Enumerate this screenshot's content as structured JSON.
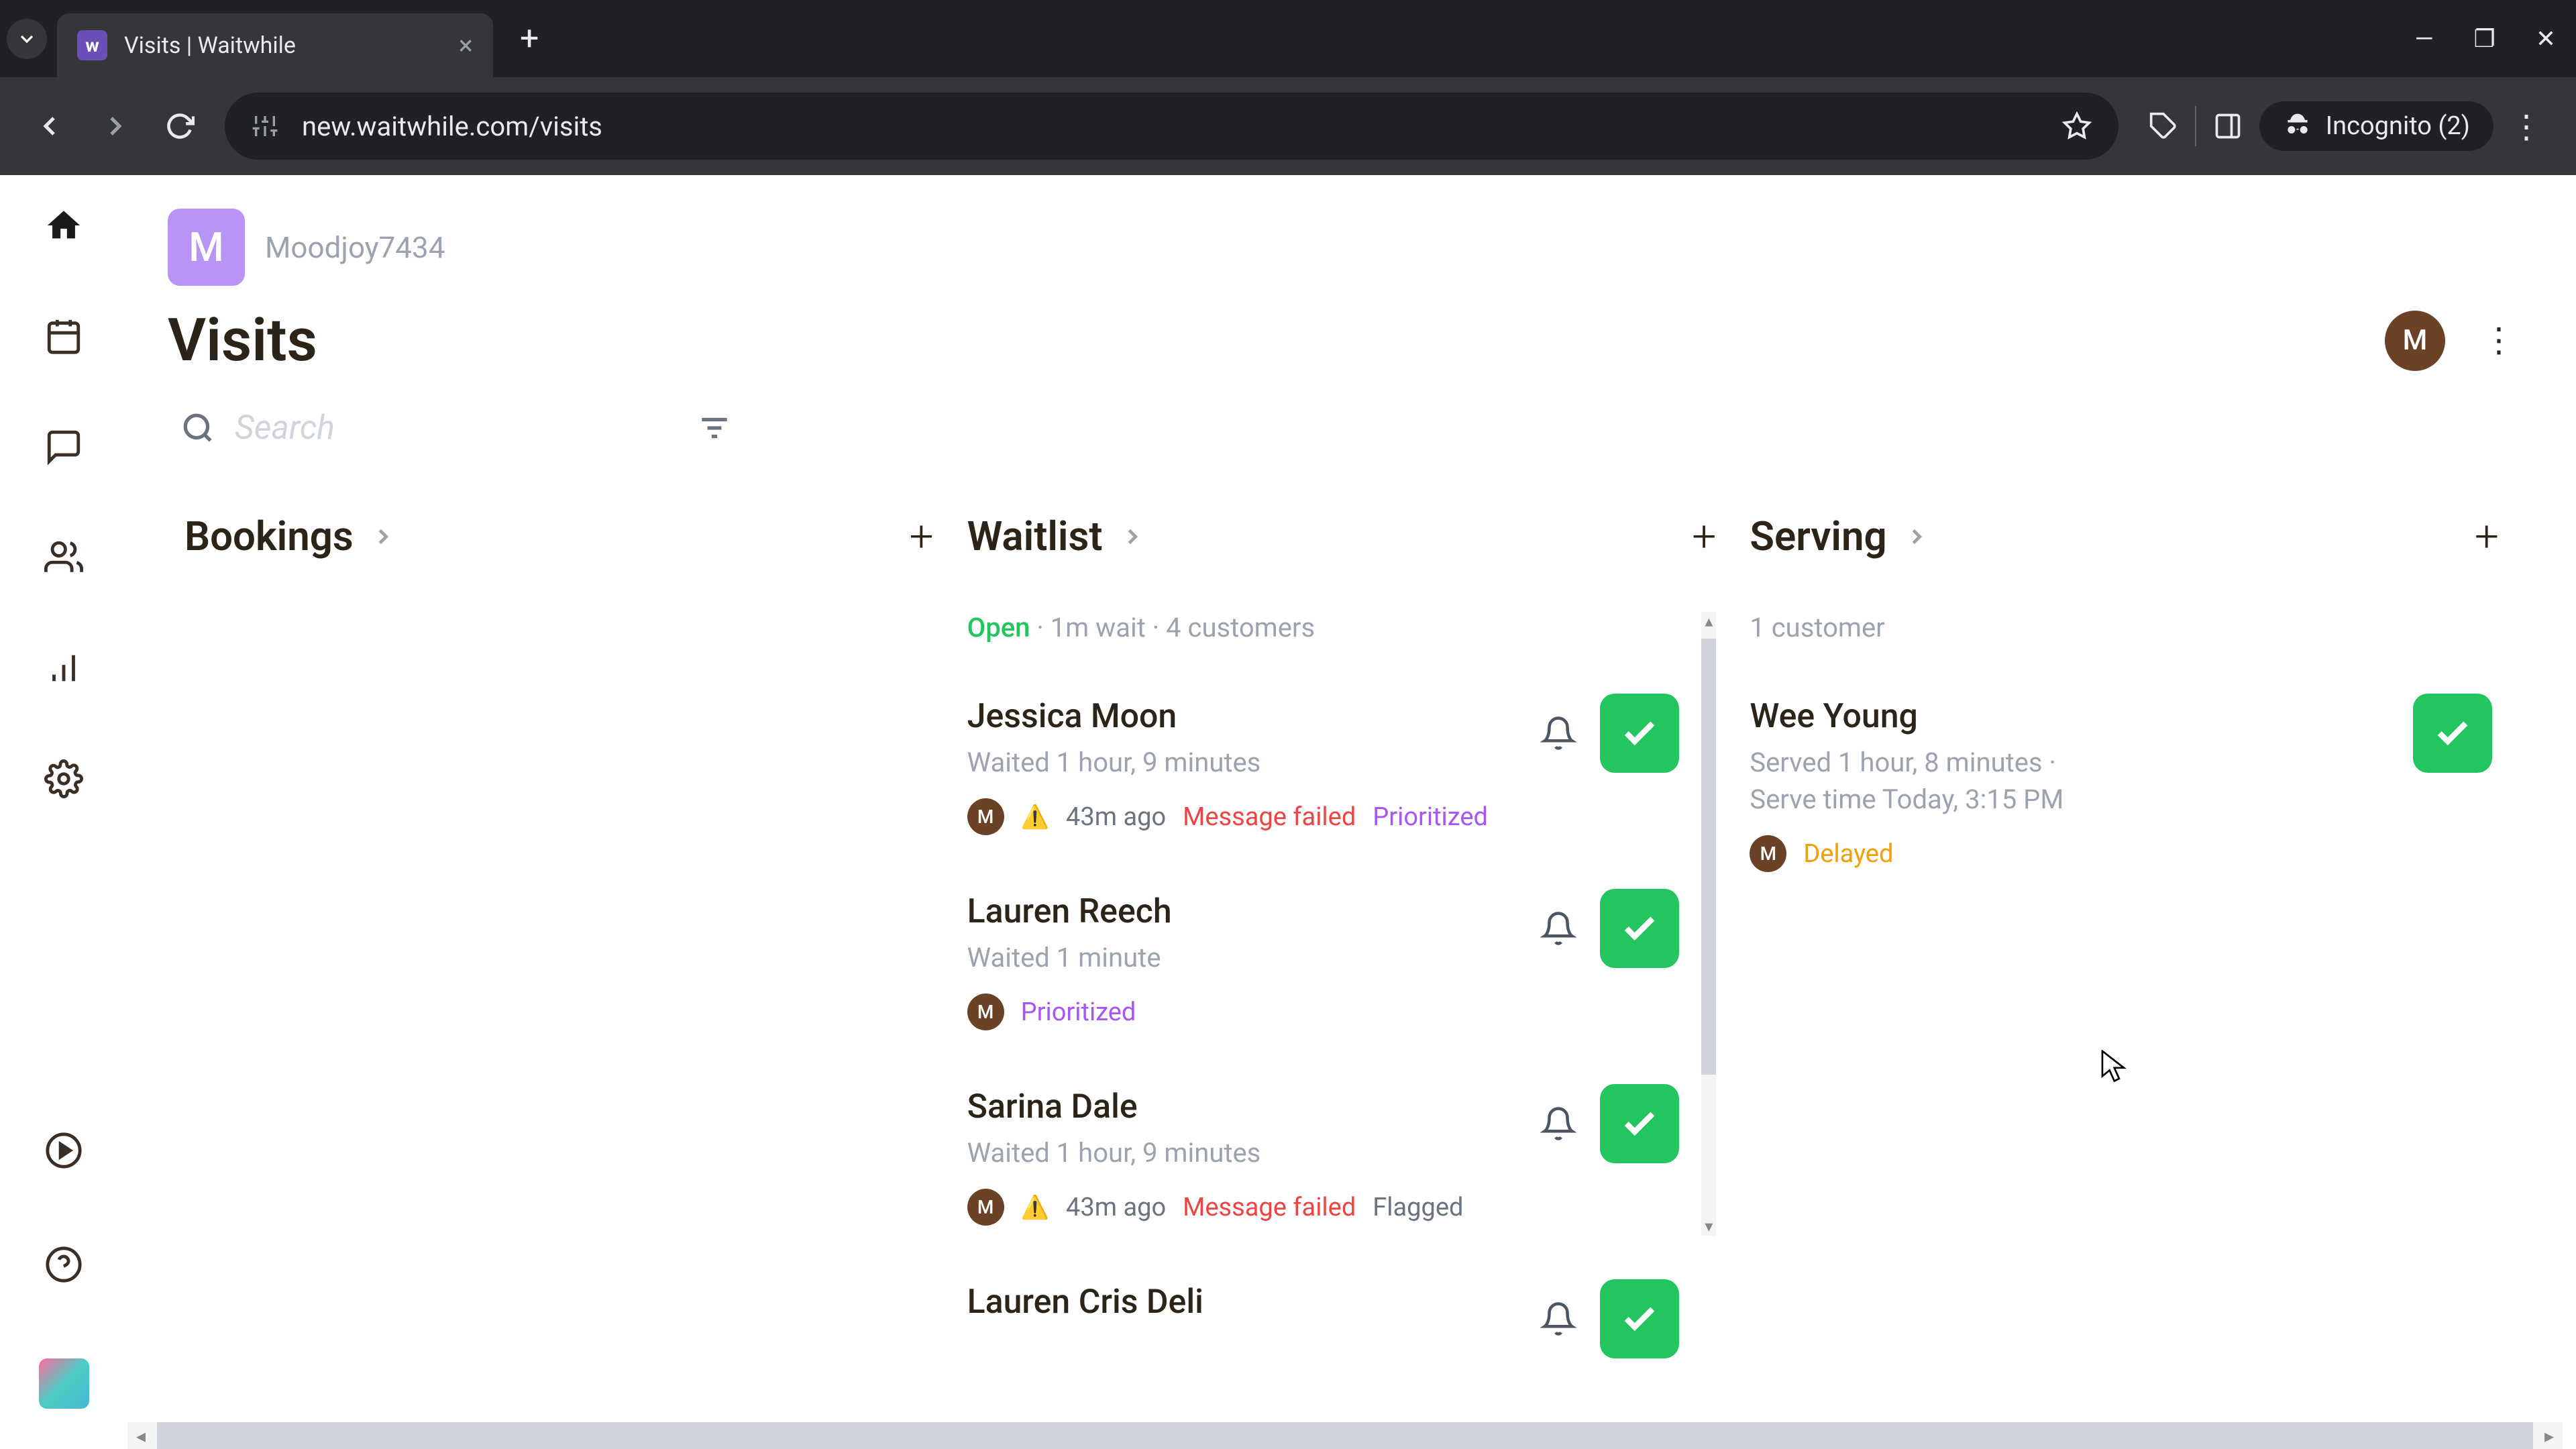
{
  "browser": {
    "tab_title": "Visits | Waitwhile",
    "url": "new.waitwhile.com/visits",
    "incognito_label": "Incognito (2)"
  },
  "workspace": {
    "badge_letter": "M",
    "name": "Moodjoy7434"
  },
  "page": {
    "title": "Visits",
    "avatar_letter": "M"
  },
  "search": {
    "placeholder": "Search"
  },
  "columns": {
    "bookings": {
      "title": "Bookings"
    },
    "waitlist": {
      "title": "Waitlist",
      "status_open": "Open",
      "status_rest": " · 1m wait · 4 customers",
      "items": [
        {
          "name": "Jessica Moon",
          "sub": "Waited 1 hour, 9 minutes",
          "avatar": "M",
          "warn": "⚠️",
          "time": "43m ago",
          "failed": "Message failed",
          "prioritized": "Prioritized",
          "flagged": "",
          "show_bell": true
        },
        {
          "name": "Lauren Reech",
          "sub": "Waited 1 minute",
          "avatar": "M",
          "warn": "",
          "time": "",
          "failed": "",
          "prioritized": "Prioritized",
          "flagged": "",
          "show_bell": true
        },
        {
          "name": "Sarina Dale",
          "sub": "Waited 1 hour, 9 minutes",
          "avatar": "M",
          "warn": "⚠️",
          "time": "43m ago",
          "failed": "Message failed",
          "prioritized": "",
          "flagged": "Flagged",
          "show_bell": true
        },
        {
          "name": "Lauren Cris Deli",
          "sub": "",
          "avatar": "",
          "warn": "",
          "time": "",
          "failed": "",
          "prioritized": "",
          "flagged": "",
          "show_bell": true
        }
      ]
    },
    "serving": {
      "title": "Serving",
      "status": "1 customer",
      "items": [
        {
          "name": "Wee Young",
          "sub1": "Served 1 hour, 8 minutes ·",
          "sub2": "Serve time Today, 3:15 PM",
          "avatar": "M",
          "delayed": "Delayed"
        }
      ]
    }
  }
}
